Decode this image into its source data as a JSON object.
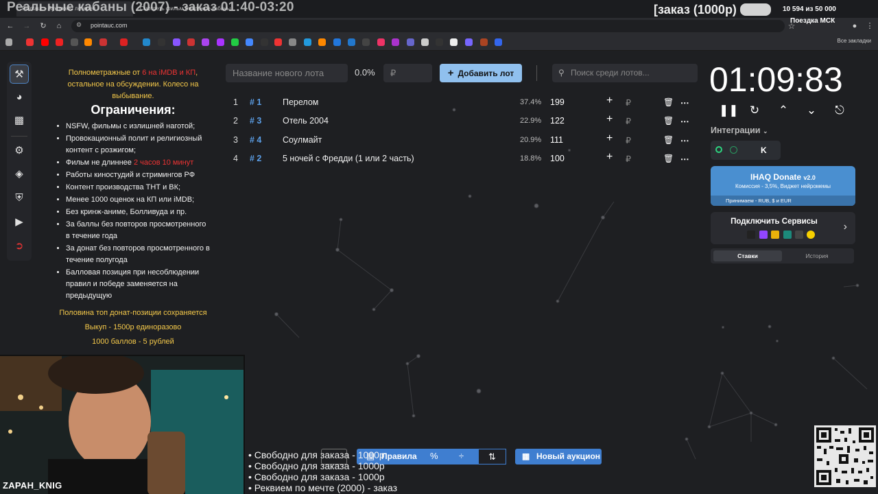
{
  "browser": {
    "tabs": [
      {
        "label": "Pointauc - Аукционы лотерея"
      },
      {
        "label": "Смотреть фильм Реальные кабаны"
      }
    ],
    "url": "pointauc.com",
    "all_bookmarks": "Все закладки"
  },
  "stream_overlay": {
    "title": "Реальные кабаны (2007) - заказ 01:40-03:20",
    "order_label": "[заказ (1000р)",
    "counter": "10 594  из 50 000",
    "trip_label": "Поездка МСК",
    "streamer_name": "ZAPAH_KNIG",
    "subtitles": [
      "• Свободно для заказа - 1000р",
      "• Свободно для заказа - 1000р",
      "• Свободно для заказа - 1000р",
      "• Реквием по мечте (2000) - заказ"
    ]
  },
  "rules": {
    "intro_a": "Полнометражные от ",
    "intro_red": "6 на iMDB и КП",
    "intro_b": ", остальное на обсуждении. Колесо на выбывание.",
    "heading": "Ограничения:",
    "items": [
      "NSFW, фильмы с излишней наготой;",
      "Провокационный полит и религиозный контент с розжигом;",
      "Фильм не длиннее ",
      "Работы киностудий и стримингов РФ",
      "Контент производства ТНТ и ВК;",
      "Менее 1000 оценок на КП или iMDB;",
      "Без кринж-аниме, Болливуда и пр.",
      "За баллы без повторов просмотренного в течение года",
      "За донат без повторов просмотренного в течение полугода",
      "Балловая позиция при несоблюдении правил и победе заменяется на предыдущую"
    ],
    "duration_red": "2 часов 10 минут",
    "footer": [
      "Половина топ донат-позиции сохраняется",
      "Выкуп - 1500р единоразово",
      "1000 баллов - 5 рублей"
    ]
  },
  "controls": {
    "new_lot_placeholder": "Название нового лота",
    "percent": "0.0%",
    "amount_placeholder": "₽",
    "add_lot": "Добавить лот",
    "search_placeholder": "Поиск среди лотов..."
  },
  "lots": [
    {
      "idx": "1",
      "id": "# 1",
      "name": "Перелом",
      "pct": "37.4%",
      "amount": "199"
    },
    {
      "idx": "2",
      "id": "# 3",
      "name": "Отель 2004",
      "pct": "22.9%",
      "amount": "122"
    },
    {
      "idx": "3",
      "id": "# 4",
      "name": "Соулмайт",
      "pct": "20.9%",
      "amount": "111"
    },
    {
      "idx": "4",
      "id": "# 2",
      "name": "5 ночей с Фредди (1 или 2 часть)",
      "pct": "18.8%",
      "amount": "100"
    }
  ],
  "lot_currency": "₽",
  "timer": "01:09:83",
  "integrations": {
    "label": "Интеграции",
    "donate_title": "IHAQ Donate",
    "donate_version": "v2.0",
    "donate_sub": "Комиссия - 3,5%, Виджет нейромемы",
    "donate_pay": "Принимаем - RUB, $ и EUR",
    "services_title": "Подключить Сервисы"
  },
  "history_tabs": {
    "bets": "Ставки",
    "history": "История"
  },
  "bottom_toolbar": {
    "rules": "Правила",
    "new_auction": "Новый аукцион"
  },
  "colors": {
    "accent": "#3f7ed0",
    "add_button": "#90c0ee",
    "lot_id": "#5b9ee6",
    "warning": "#ee3333",
    "highlight": "#f5c94a"
  }
}
